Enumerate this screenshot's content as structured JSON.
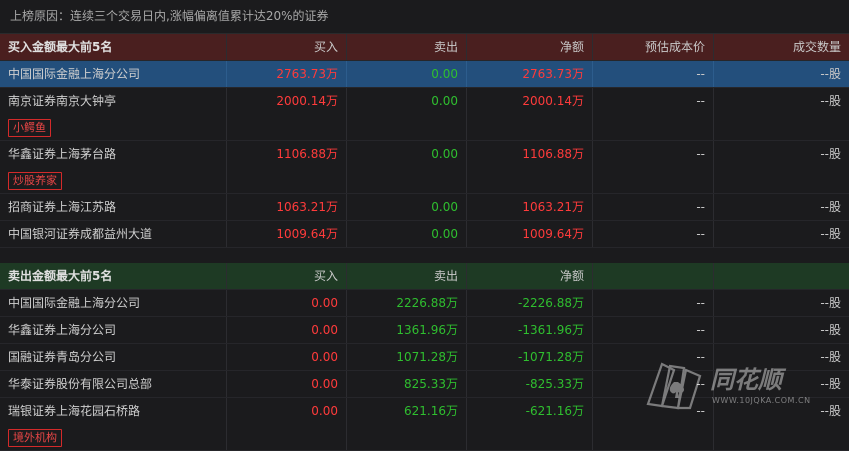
{
  "reason": "上榜原因：连续三个交易日内,涨幅偏离值累计达20%的证券",
  "buy_section": {
    "header": {
      "title": "买入金额最大前5名",
      "buy": "买入",
      "sell": "卖出",
      "net": "净额",
      "cost": "预估成本价",
      "volume": "成交数量"
    },
    "rows": [
      {
        "name": "中国国际金融上海分公司",
        "buy": "2763.73万",
        "sell": "0.00",
        "net": "2763.73万",
        "cost": "--",
        "volume": "--股",
        "tag": ""
      },
      {
        "name": "南京证券南京大钟亭",
        "buy": "2000.14万",
        "sell": "0.00",
        "net": "2000.14万",
        "cost": "--",
        "volume": "--股",
        "tag": "小鳄鱼"
      },
      {
        "name": "华鑫证券上海茅台路",
        "buy": "1106.88万",
        "sell": "0.00",
        "net": "1106.88万",
        "cost": "--",
        "volume": "--股",
        "tag": "炒股养家"
      },
      {
        "name": "招商证券上海江苏路",
        "buy": "1063.21万",
        "sell": "0.00",
        "net": "1063.21万",
        "cost": "--",
        "volume": "--股",
        "tag": ""
      },
      {
        "name": "中国银河证券成都益州大道",
        "buy": "1009.64万",
        "sell": "0.00",
        "net": "1009.64万",
        "cost": "--",
        "volume": "--股",
        "tag": ""
      }
    ]
  },
  "sell_section": {
    "header": {
      "title": "卖出金额最大前5名",
      "buy": "买入",
      "sell": "卖出",
      "net": "净额"
    },
    "rows": [
      {
        "name": "中国国际金融上海分公司",
        "buy": "0.00",
        "sell": "2226.88万",
        "net": "-2226.88万",
        "cost": "--",
        "volume": "--股",
        "tag": ""
      },
      {
        "name": "华鑫证券上海分公司",
        "buy": "0.00",
        "sell": "1361.96万",
        "net": "-1361.96万",
        "cost": "--",
        "volume": "--股",
        "tag": ""
      },
      {
        "name": "国融证券青岛分公司",
        "buy": "0.00",
        "sell": "1071.28万",
        "net": "-1071.28万",
        "cost": "--",
        "volume": "--股",
        "tag": ""
      },
      {
        "name": "华泰证券股份有限公司总部",
        "buy": "0.00",
        "sell": "825.33万",
        "net": "-825.33万",
        "cost": "--",
        "volume": "--股",
        "tag": ""
      },
      {
        "name": "瑞银证券上海花园石桥路",
        "buy": "0.00",
        "sell": "621.16万",
        "net": "-621.16万",
        "cost": "--",
        "volume": "--股",
        "tag": "境外机构"
      }
    ]
  },
  "watermark": {
    "brand": "同花顺",
    "url": "WWW.10JQKA.COM.CN"
  },
  "colors": {
    "positive": "#ff3b3b",
    "negative": "#2fbf2f",
    "selected_row": "#234f7c",
    "buy_header": "#4a1f1f",
    "sell_header": "#1e3a24"
  }
}
